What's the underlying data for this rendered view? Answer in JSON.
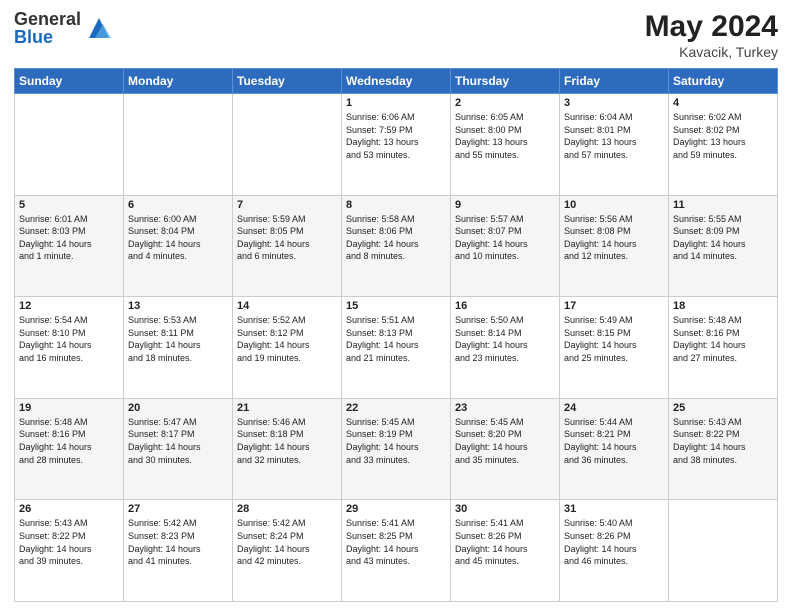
{
  "header": {
    "logo_general": "General",
    "logo_blue": "Blue",
    "month_year": "May 2024",
    "location": "Kavacik, Turkey"
  },
  "days_of_week": [
    "Sunday",
    "Monday",
    "Tuesday",
    "Wednesday",
    "Thursday",
    "Friday",
    "Saturday"
  ],
  "weeks": [
    [
      {
        "day": "",
        "content": ""
      },
      {
        "day": "",
        "content": ""
      },
      {
        "day": "",
        "content": ""
      },
      {
        "day": "1",
        "content": "Sunrise: 6:06 AM\nSunset: 7:59 PM\nDaylight: 13 hours\nand 53 minutes."
      },
      {
        "day": "2",
        "content": "Sunrise: 6:05 AM\nSunset: 8:00 PM\nDaylight: 13 hours\nand 55 minutes."
      },
      {
        "day": "3",
        "content": "Sunrise: 6:04 AM\nSunset: 8:01 PM\nDaylight: 13 hours\nand 57 minutes."
      },
      {
        "day": "4",
        "content": "Sunrise: 6:02 AM\nSunset: 8:02 PM\nDaylight: 13 hours\nand 59 minutes."
      }
    ],
    [
      {
        "day": "5",
        "content": "Sunrise: 6:01 AM\nSunset: 8:03 PM\nDaylight: 14 hours\nand 1 minute."
      },
      {
        "day": "6",
        "content": "Sunrise: 6:00 AM\nSunset: 8:04 PM\nDaylight: 14 hours\nand 4 minutes."
      },
      {
        "day": "7",
        "content": "Sunrise: 5:59 AM\nSunset: 8:05 PM\nDaylight: 14 hours\nand 6 minutes."
      },
      {
        "day": "8",
        "content": "Sunrise: 5:58 AM\nSunset: 8:06 PM\nDaylight: 14 hours\nand 8 minutes."
      },
      {
        "day": "9",
        "content": "Sunrise: 5:57 AM\nSunset: 8:07 PM\nDaylight: 14 hours\nand 10 minutes."
      },
      {
        "day": "10",
        "content": "Sunrise: 5:56 AM\nSunset: 8:08 PM\nDaylight: 14 hours\nand 12 minutes."
      },
      {
        "day": "11",
        "content": "Sunrise: 5:55 AM\nSunset: 8:09 PM\nDaylight: 14 hours\nand 14 minutes."
      }
    ],
    [
      {
        "day": "12",
        "content": "Sunrise: 5:54 AM\nSunset: 8:10 PM\nDaylight: 14 hours\nand 16 minutes."
      },
      {
        "day": "13",
        "content": "Sunrise: 5:53 AM\nSunset: 8:11 PM\nDaylight: 14 hours\nand 18 minutes."
      },
      {
        "day": "14",
        "content": "Sunrise: 5:52 AM\nSunset: 8:12 PM\nDaylight: 14 hours\nand 19 minutes."
      },
      {
        "day": "15",
        "content": "Sunrise: 5:51 AM\nSunset: 8:13 PM\nDaylight: 14 hours\nand 21 minutes."
      },
      {
        "day": "16",
        "content": "Sunrise: 5:50 AM\nSunset: 8:14 PM\nDaylight: 14 hours\nand 23 minutes."
      },
      {
        "day": "17",
        "content": "Sunrise: 5:49 AM\nSunset: 8:15 PM\nDaylight: 14 hours\nand 25 minutes."
      },
      {
        "day": "18",
        "content": "Sunrise: 5:48 AM\nSunset: 8:16 PM\nDaylight: 14 hours\nand 27 minutes."
      }
    ],
    [
      {
        "day": "19",
        "content": "Sunrise: 5:48 AM\nSunset: 8:16 PM\nDaylight: 14 hours\nand 28 minutes."
      },
      {
        "day": "20",
        "content": "Sunrise: 5:47 AM\nSunset: 8:17 PM\nDaylight: 14 hours\nand 30 minutes."
      },
      {
        "day": "21",
        "content": "Sunrise: 5:46 AM\nSunset: 8:18 PM\nDaylight: 14 hours\nand 32 minutes."
      },
      {
        "day": "22",
        "content": "Sunrise: 5:45 AM\nSunset: 8:19 PM\nDaylight: 14 hours\nand 33 minutes."
      },
      {
        "day": "23",
        "content": "Sunrise: 5:45 AM\nSunset: 8:20 PM\nDaylight: 14 hours\nand 35 minutes."
      },
      {
        "day": "24",
        "content": "Sunrise: 5:44 AM\nSunset: 8:21 PM\nDaylight: 14 hours\nand 36 minutes."
      },
      {
        "day": "25",
        "content": "Sunrise: 5:43 AM\nSunset: 8:22 PM\nDaylight: 14 hours\nand 38 minutes."
      }
    ],
    [
      {
        "day": "26",
        "content": "Sunrise: 5:43 AM\nSunset: 8:22 PM\nDaylight: 14 hours\nand 39 minutes."
      },
      {
        "day": "27",
        "content": "Sunrise: 5:42 AM\nSunset: 8:23 PM\nDaylight: 14 hours\nand 41 minutes."
      },
      {
        "day": "28",
        "content": "Sunrise: 5:42 AM\nSunset: 8:24 PM\nDaylight: 14 hours\nand 42 minutes."
      },
      {
        "day": "29",
        "content": "Sunrise: 5:41 AM\nSunset: 8:25 PM\nDaylight: 14 hours\nand 43 minutes."
      },
      {
        "day": "30",
        "content": "Sunrise: 5:41 AM\nSunset: 8:26 PM\nDaylight: 14 hours\nand 45 minutes."
      },
      {
        "day": "31",
        "content": "Sunrise: 5:40 AM\nSunset: 8:26 PM\nDaylight: 14 hours\nand 46 minutes."
      },
      {
        "day": "",
        "content": ""
      }
    ]
  ]
}
